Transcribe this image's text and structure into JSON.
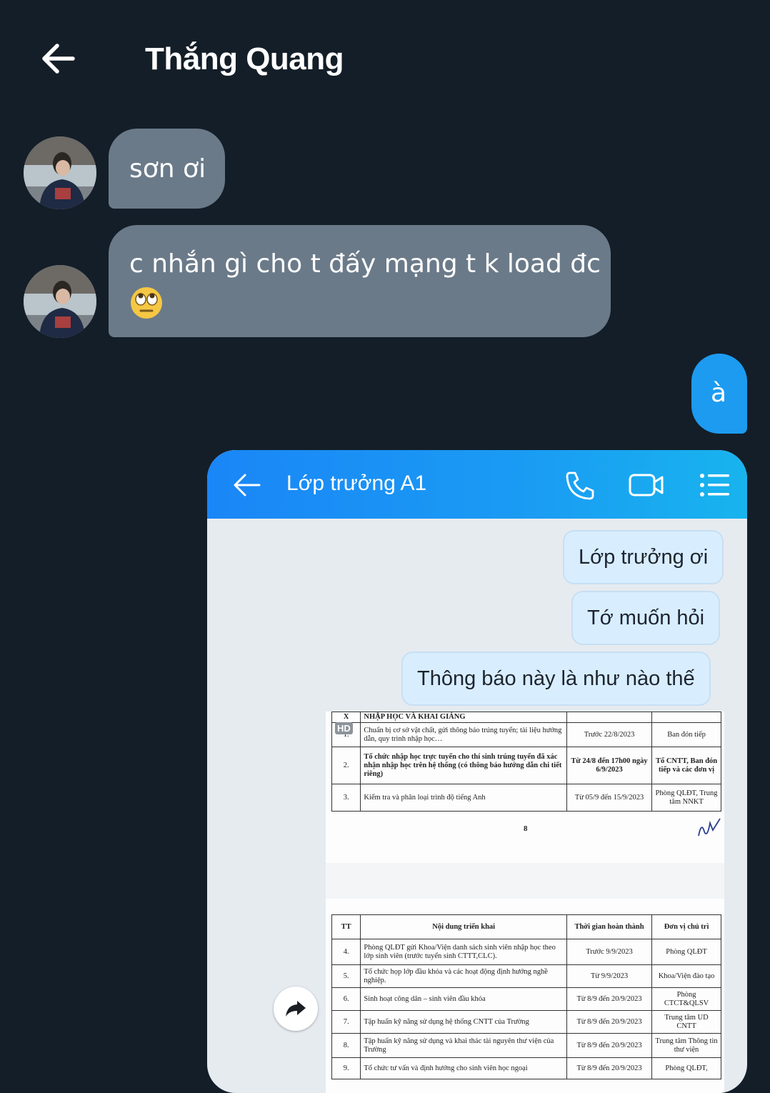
{
  "header": {
    "title": "Thắng Quang"
  },
  "messages": {
    "m1": "sơn ơi",
    "m2": "c nhắn gì cho t đấy mạng t k load đc",
    "m2_emoji": "🙄",
    "m3": "à"
  },
  "screenshot": {
    "title": "Lớp trưởng A1",
    "bubbles": [
      "Lớp trưởng ơi",
      "Tớ muốn hỏi",
      "Thông báo này là như nào thế"
    ],
    "doc": {
      "hd": "HD",
      "page_number": "8",
      "table1": {
        "section_roman": "X",
        "section_title": "NHẬP HỌC VÀ KHAI GIẢNG",
        "rows": [
          {
            "no": "1.",
            "content": "Chuẩn bị cơ sở vật chất, gửi thông báo trúng tuyển; tài liệu hướng dẫn, quy trình nhập học…",
            "time": "Trước 22/8/2023",
            "unit": "Ban đón tiếp"
          },
          {
            "no": "2.",
            "content": "Tổ chức nhập học trực tuyến cho thí sinh trúng tuyển đã xác nhận nhập học trên hệ thống (có thông báo hướng dẫn chi tiết riêng)",
            "time": "Từ 24/8 đến 17h00 ngày 6/9/2023",
            "unit": "Tổ CNTT, Ban đón tiếp và các đơn vị"
          },
          {
            "no": "3.",
            "content": "Kiểm tra và phân loại trình độ tiếng Anh",
            "time": "Từ 05/9 đến 15/9/2023",
            "unit": "Phòng QLĐT, Trung tâm NNKT"
          }
        ]
      },
      "table2": {
        "headers": [
          "TT",
          "Nội dung triển khai",
          "Thời gian hoàn thành",
          "Đơn vị chủ trì"
        ],
        "rows": [
          {
            "no": "4.",
            "content": "Phòng QLĐT gửi Khoa/Viện danh sách sinh viên nhập học theo lớp sinh viên (trước tuyển sinh CTTT,CLC).",
            "time": "Trước 9/9/2023",
            "unit": "Phòng QLĐT"
          },
          {
            "no": "5.",
            "content": "Tổ chức họp lớp đầu khóa và các hoạt động định hướng nghề nghiệp.",
            "time": "Từ 9/9/2023",
            "unit": "Khoa/Viện đào tạo"
          },
          {
            "no": "6.",
            "content": "Sinh hoạt công dân – sinh viên đầu khóa",
            "time": "Từ 8/9 đến 20/9/2023",
            "unit": "Phòng CTCT&QLSV"
          },
          {
            "no": "7.",
            "content": "Tập huấn kỹ năng sử dụng hệ thống CNTT của Trường",
            "time": "Từ 8/9 đến 20/9/2023",
            "unit": "Trung tâm UD CNTT"
          },
          {
            "no": "8.",
            "content": "Tập huấn kỹ năng sử dụng và khai thác tài nguyên thư viện của Trường",
            "time": "Từ 8/9 đến 20/9/2023",
            "unit": "Trung tâm Thông tin thư viện"
          },
          {
            "no": "9.",
            "content": "Tổ chức tư vấn và định hướng cho sinh viên học ngoại",
            "time": "Từ 8/9 đến 20/9/2023",
            "unit": "Phòng QLĐT,"
          }
        ]
      }
    }
  },
  "colors": {
    "background": "#141e28",
    "incoming_bubble": "#6a7a89",
    "outgoing_bubble": "#1d9bf0"
  }
}
